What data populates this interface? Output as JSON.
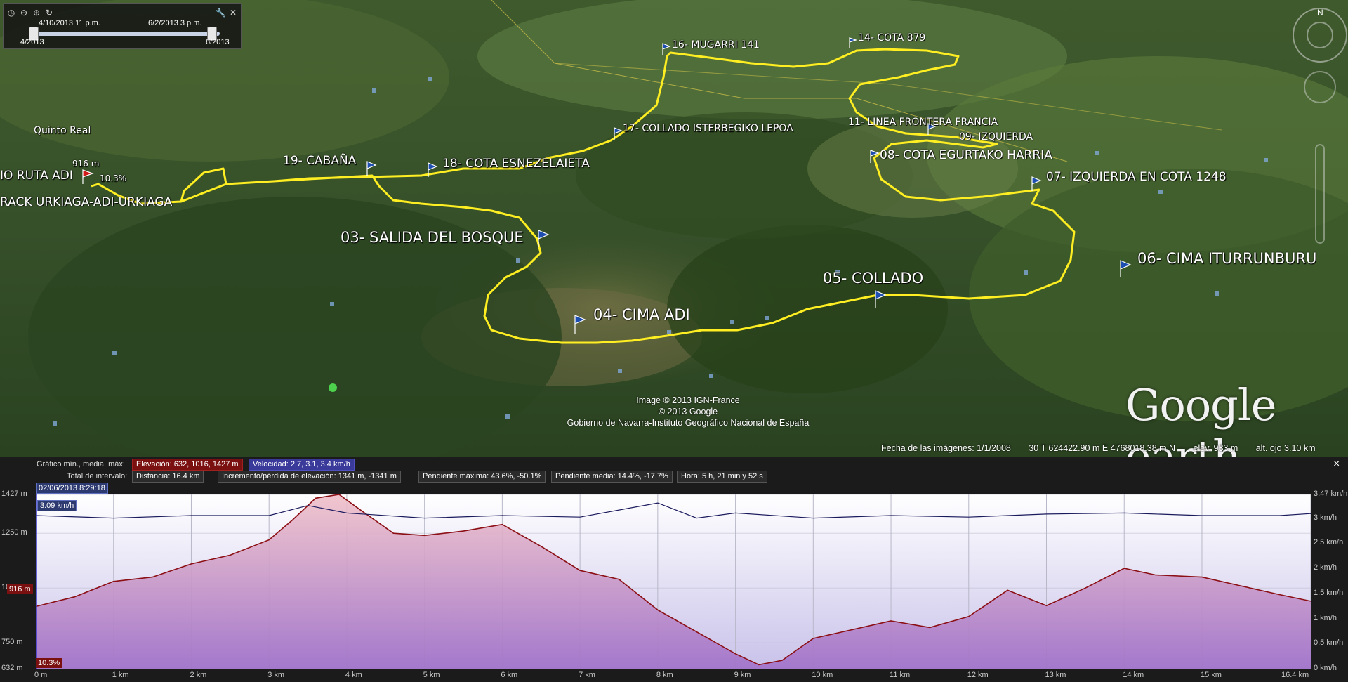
{
  "time_slider": {
    "start_label": "4/10/2013  11 p.m.",
    "end_label": "6/2/2013   3 p.m.",
    "range_start": "4/2013",
    "range_end": "6/2013"
  },
  "map": {
    "placemarks": [
      {
        "label": "16- MUGARRI 141",
        "size": "small"
      },
      {
        "label": "14- COTA 879",
        "size": "small"
      },
      {
        "label": "17- COLLADO ISTERBEGIKO LEPOA",
        "size": "small"
      },
      {
        "label": "11- LINEA FRONTERA FRANCIA",
        "size": "small"
      },
      {
        "label": "09- IZQUIERDA",
        "size": "small"
      },
      {
        "label": "08- COTA EGURTAKO HARRIA",
        "size": "med"
      },
      {
        "label": "19- CABAÑA",
        "size": "med"
      },
      {
        "label": "18- COTA ESNEZELAIETA",
        "size": "med"
      },
      {
        "label": "07- IZQUIERDA EN COTA 1248",
        "size": "med"
      },
      {
        "label": "IO RUTA ADI",
        "size": "med"
      },
      {
        "label": "RACK URKIAGA-ADI-URKIAGA",
        "size": "med"
      },
      {
        "label": "03- SALIDA DEL BOSQUE",
        "size": "big"
      },
      {
        "label": "06- CIMA ITURRUNBURU",
        "size": "big"
      },
      {
        "label": "05- COLLADO",
        "size": "big"
      },
      {
        "label": "04- CIMA ADI",
        "size": "big"
      },
      {
        "label": "Quinto Real",
        "size": "small"
      }
    ],
    "cursor_elevation": "916 m",
    "cursor_slope": "10.3%",
    "credits": [
      "Image © 2013 IGN-France",
      "© 2013 Google",
      "Gobierno de Navarra-Instituto Geográfico Nacional de España"
    ],
    "brand": "Google earth",
    "status": {
      "imagery_date": "Fecha de las imágenes: 1/1/2008",
      "coords": "30 T 624422.90 m E 4768018.38 m N",
      "elev": "elev.   933 m",
      "eye_alt": "alt. ojo    3.10 km"
    },
    "compass_north": "N"
  },
  "profile": {
    "row1_label": "Gráfico  mín., media, máx:",
    "elevation_chip": "Elevación: 632, 1016, 1427 m",
    "speed_chip": "Velocidad: 2.7, 3.1, 3.4 km/h",
    "row2_label": "Total de intervalo:",
    "distance_chip": "Distancia: 16.4 km",
    "gain_chip": "Incremento/pérdida de elevación: 1341 m, -1341 m",
    "max_slope_chip": "Pendiente máxima: 43.6%, -50.1%",
    "avg_slope_chip": "Pendiente media: 14.4%, -17.7%",
    "time_chip": "Hora: 5 h, 21 min y 52 s",
    "timestamp": "02/06/2013 8:29:18",
    "speed_marker": "3.09 km/h",
    "elev_marker": "916 m",
    "slope_marker": "10.3%",
    "close": "×"
  },
  "chart_data": {
    "type": "line",
    "x_unit": "km",
    "x_ticks": [
      "0 m",
      "1 km",
      "2 km",
      "3 km",
      "4 km",
      "5 km",
      "6 km",
      "7 km",
      "8 km",
      "9 km",
      "10 km",
      "11 km",
      "12 km",
      "13 km",
      "14 km",
      "15 km",
      "16.4 km"
    ],
    "y_left_ticks": [
      "1427 m",
      "1250 m",
      "1000 m",
      "750 m",
      "632 m"
    ],
    "y_right_ticks": [
      "3.47 km/h",
      "3 km/h",
      "2.5 km/h",
      "2 km/h",
      "1.5 km/h",
      "1 km/h",
      "0.5 km/h",
      "0 km/h"
    ],
    "xlim": [
      0,
      16.4
    ],
    "ylim_left": [
      632,
      1427
    ],
    "ylim_right": [
      0,
      3.47
    ],
    "series": [
      {
        "name": "Elevación",
        "color": "#8b0f14",
        "x": [
          0,
          0.5,
          1,
          1.5,
          2,
          2.5,
          3,
          3.3,
          3.6,
          3.9,
          4.2,
          4.6,
          5,
          5.5,
          6,
          6.5,
          7,
          7.5,
          8,
          8.5,
          9,
          9.3,
          9.6,
          10,
          10.5,
          11,
          11.5,
          12,
          12.5,
          13,
          13.5,
          14,
          14.4,
          15,
          15.5,
          16,
          16.4
        ],
        "y": [
          916,
          960,
          1030,
          1050,
          1110,
          1150,
          1220,
          1310,
          1410,
          1427,
          1350,
          1250,
          1240,
          1260,
          1290,
          1190,
          1080,
          1040,
          900,
          800,
          700,
          650,
          670,
          770,
          810,
          850,
          820,
          870,
          990,
          920,
          1000,
          1090,
          1060,
          1050,
          1010,
          970,
          940
        ]
      },
      {
        "name": "Velocidad",
        "color": "#1a1a5e",
        "x": [
          0,
          1,
          2,
          3,
          3.5,
          4,
          5,
          6,
          7,
          8,
          8.5,
          9,
          10,
          11,
          12,
          13,
          14,
          15,
          16,
          16.4
        ],
        "y": [
          3.05,
          3.0,
          3.05,
          3.05,
          3.25,
          3.1,
          3.0,
          3.05,
          3.02,
          3.3,
          3.0,
          3.1,
          3.0,
          3.05,
          3.02,
          3.08,
          3.1,
          3.05,
          3.05,
          3.09
        ]
      }
    ]
  }
}
